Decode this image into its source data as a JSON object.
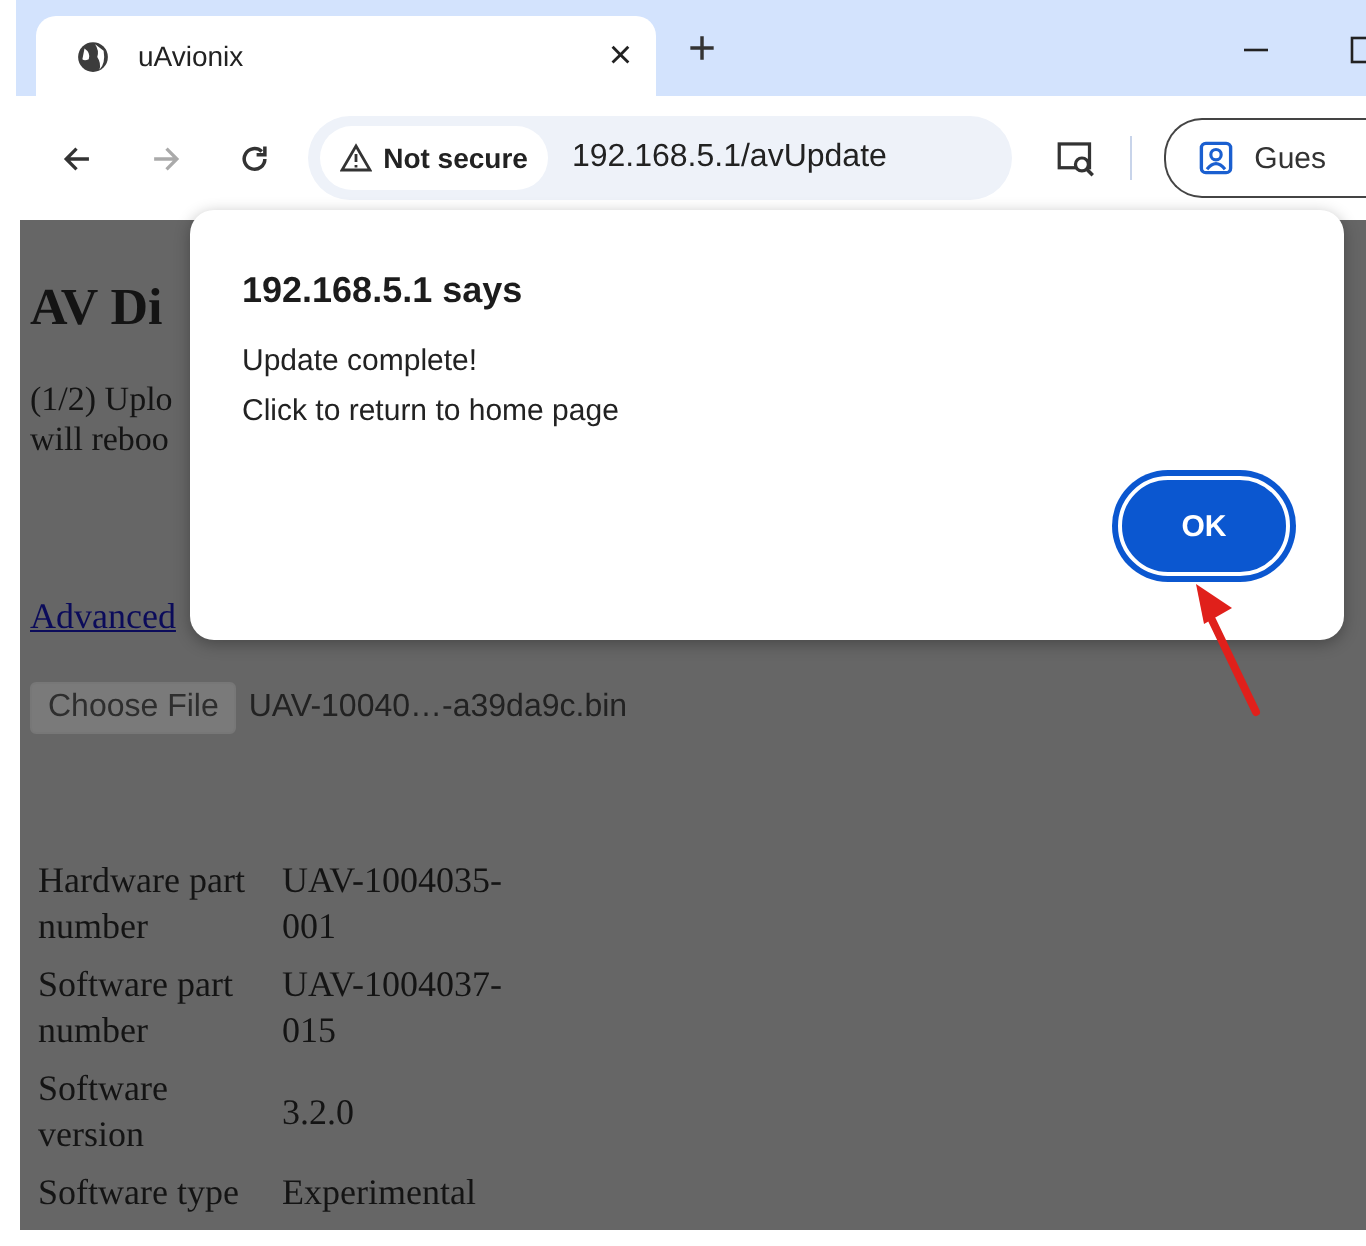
{
  "browser": {
    "tab": {
      "title": "uAvionix",
      "close": "×"
    },
    "new_tab": "+",
    "address": {
      "security": "Not secure",
      "url": "192.168.5.1/avUpdate"
    },
    "profile": {
      "label": "Gues"
    }
  },
  "page": {
    "heading": "AV Di",
    "intro_lines": [
      "(1/2) Uplo",
      "will reboo"
    ],
    "advanced_link": "Advanced",
    "file_input": {
      "button": "Choose File",
      "disabled": true,
      "filename": "UAV-10040…-a39da9c.bin"
    },
    "info": [
      {
        "label": "Hardware part number",
        "value": "UAV-1004035-001"
      },
      {
        "label": "Software part number",
        "value": "UAV-1004037-015"
      },
      {
        "label": "Software version",
        "value": "3.2.0"
      },
      {
        "label": "Software type",
        "value": "Experimental"
      }
    ]
  },
  "dialog": {
    "title": "192.168.5.1 says",
    "lines": [
      "Update complete!",
      "Click to return to home page"
    ],
    "button": "OK"
  }
}
